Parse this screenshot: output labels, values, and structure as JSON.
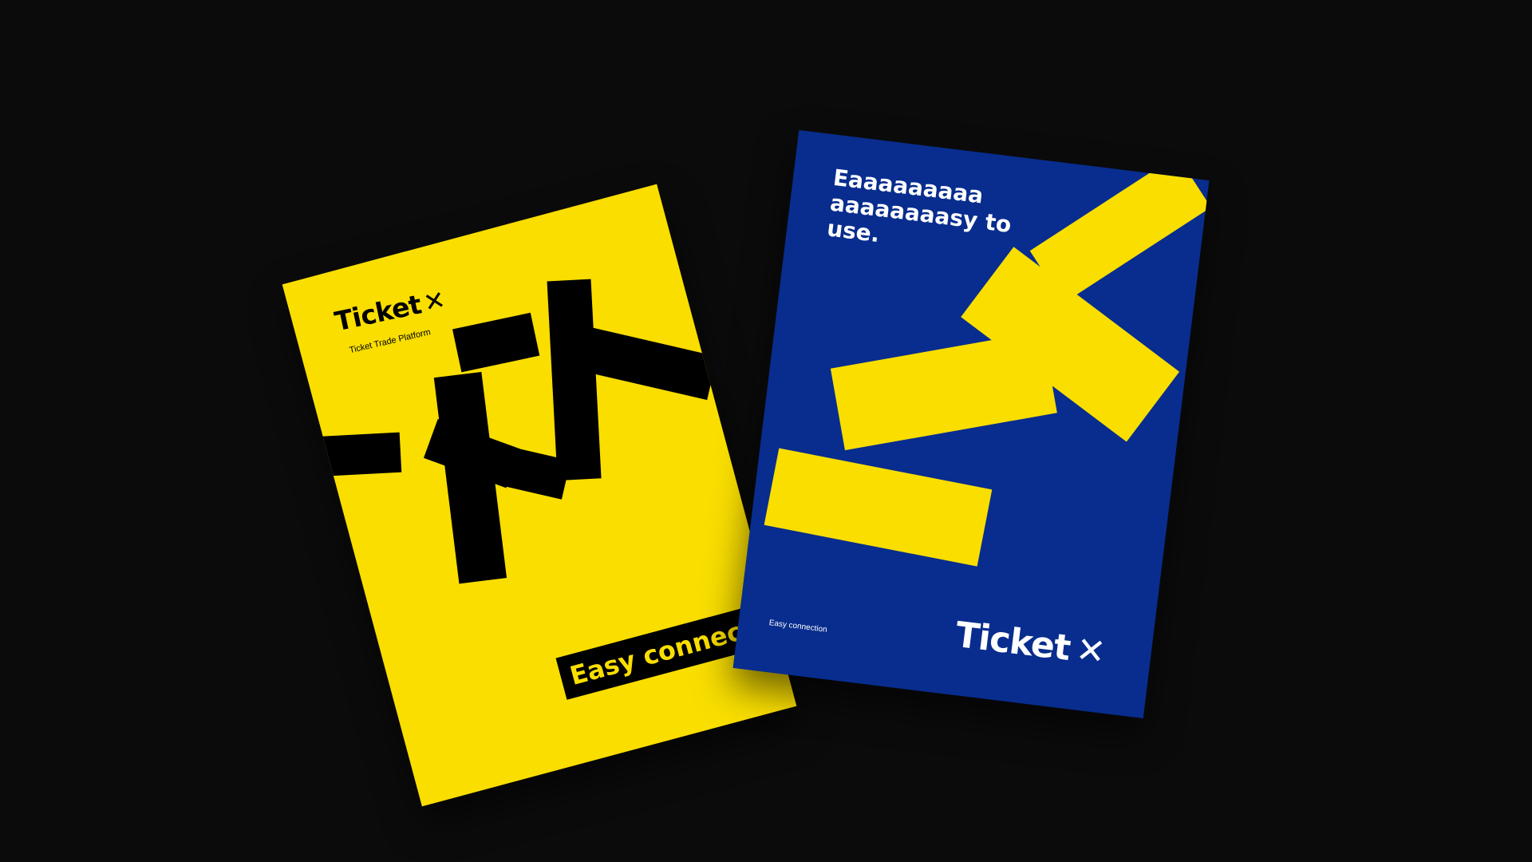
{
  "scene": {
    "background_color": "#0b0b0b"
  },
  "yellow_poster": {
    "background_color": "#f9de00",
    "ink_color": "#000000",
    "brand_name": "Ticket",
    "brand_mark": "✕",
    "tagline": "Ticket Trade Platform",
    "label": "Easy connection"
  },
  "blue_poster": {
    "background_color": "#082d8e",
    "accent_color": "#f9de00",
    "headline_lines": [
      "Eaaaaaaaaa",
      "aaaaaaaasy to",
      "use."
    ],
    "caption": "Easy connection",
    "brand_name": "Ticket",
    "brand_mark": "✕"
  }
}
